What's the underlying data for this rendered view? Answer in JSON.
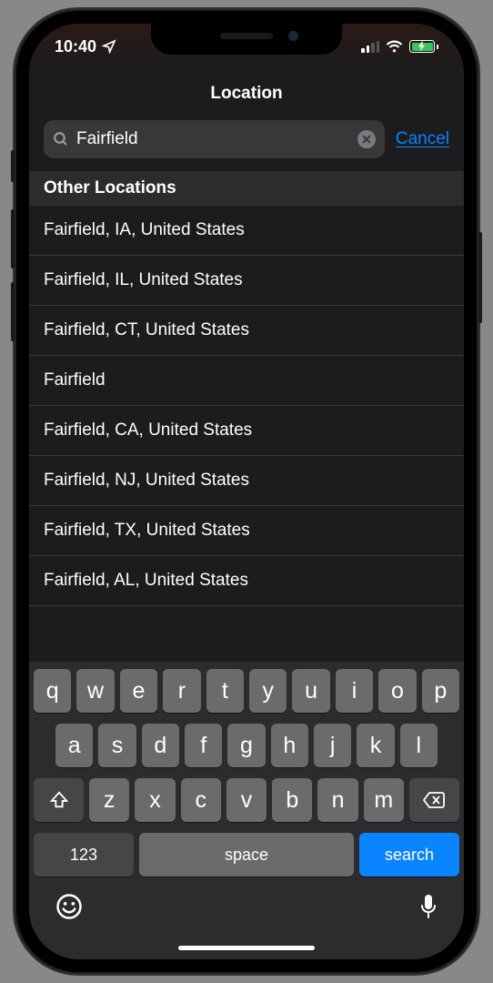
{
  "status": {
    "time": "10:40"
  },
  "nav": {
    "title": "Location"
  },
  "search": {
    "value": "Fairfield",
    "cancel": "Cancel"
  },
  "section_header": "Other Locations",
  "results": [
    "Fairfield, IA, United States",
    "Fairfield, IL, United States",
    "Fairfield, CT, United States",
    "Fairfield",
    "Fairfield, CA, United States",
    "Fairfield, NJ, United States",
    "Fairfield, TX, United States",
    "Fairfield, AL, United States"
  ],
  "keyboard": {
    "row1": [
      "q",
      "w",
      "e",
      "r",
      "t",
      "y",
      "u",
      "i",
      "o",
      "p"
    ],
    "row2": [
      "a",
      "s",
      "d",
      "f",
      "g",
      "h",
      "j",
      "k",
      "l"
    ],
    "row3": [
      "z",
      "x",
      "c",
      "v",
      "b",
      "n",
      "m"
    ],
    "numbers": "123",
    "space": "space",
    "action": "search"
  }
}
